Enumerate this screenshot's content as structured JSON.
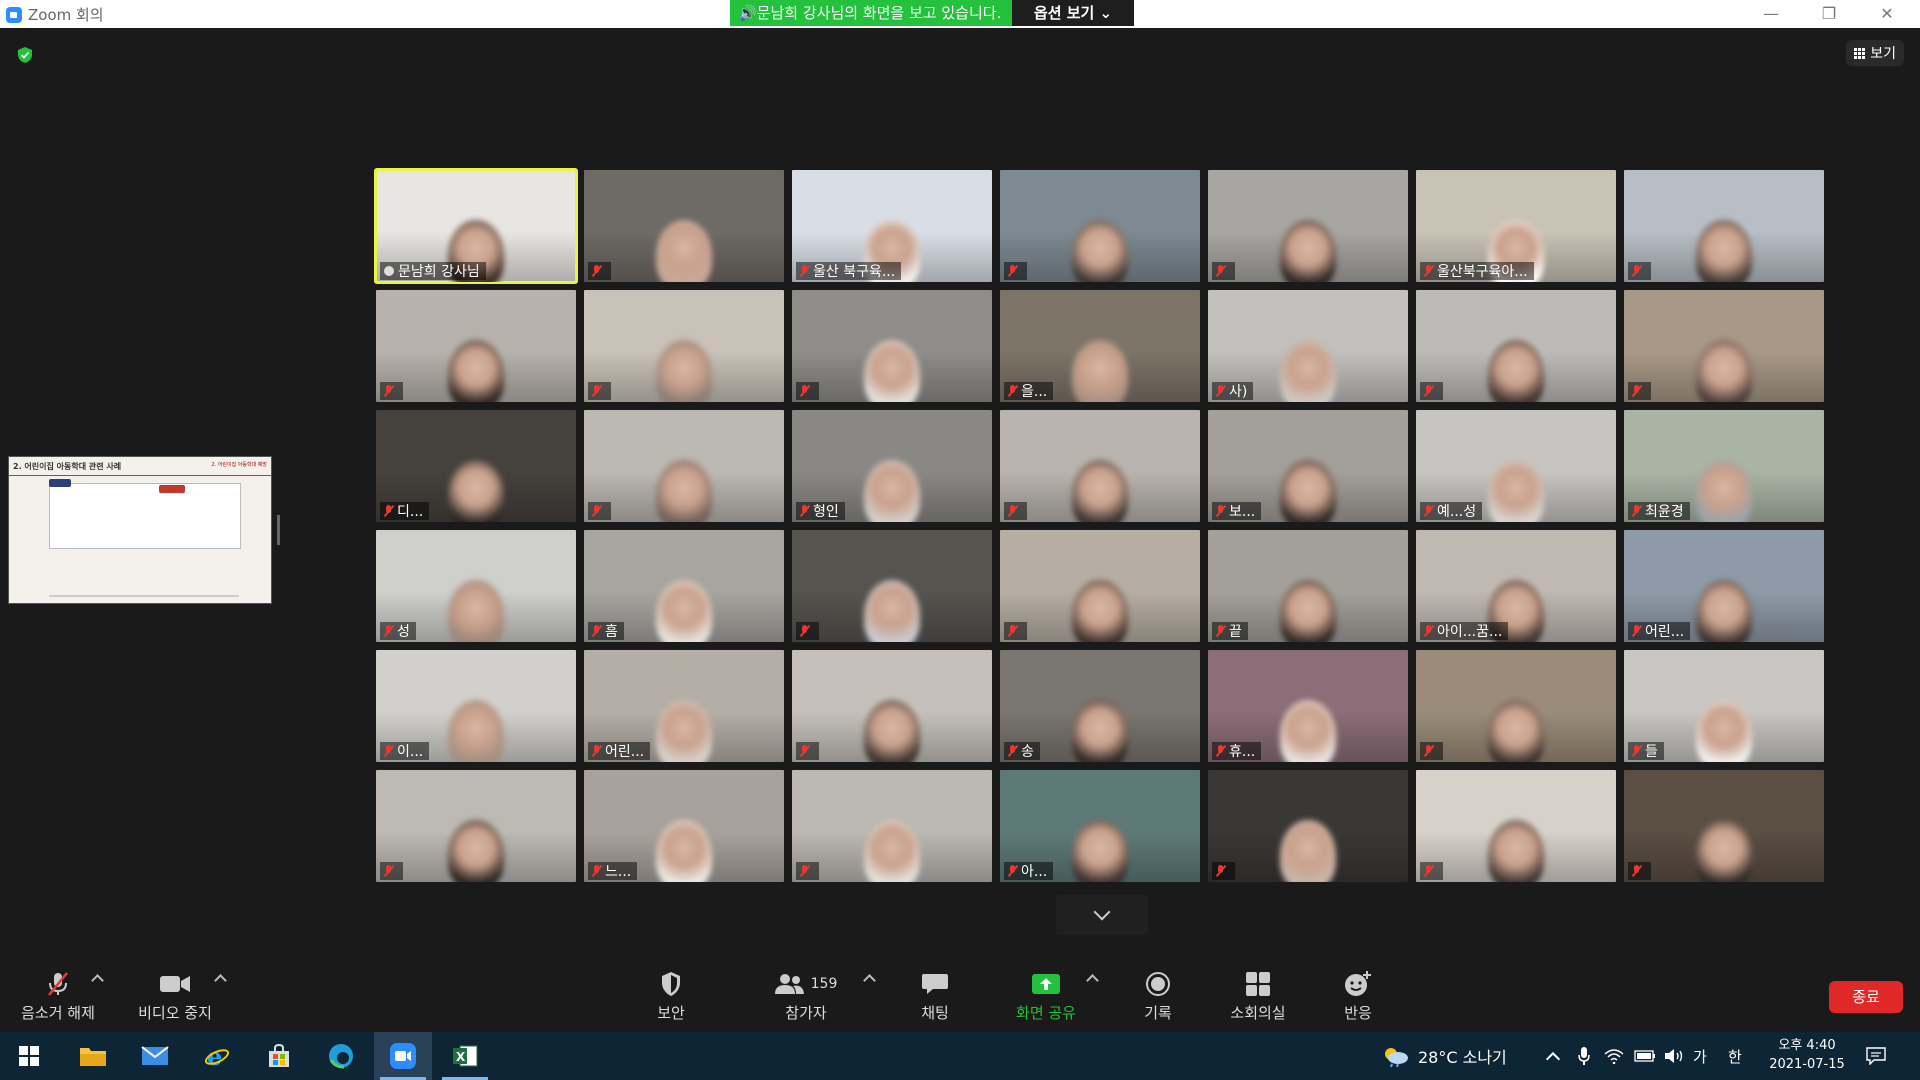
{
  "window": {
    "title": "Zoom 회의",
    "controls": [
      "—",
      "❐",
      "✕"
    ]
  },
  "banner": {
    "message": "🔊문남희 강사님의 화면을 보고 있습니다.",
    "options": "옵션 보기 ⌄"
  },
  "view_button": {
    "label": "보기"
  },
  "shared_screen": {
    "title": "2. 어린이집 아동학대 관련 사례",
    "tag": "2. 어린이집 아동학대 예방"
  },
  "participants": [
    {
      "name": "문남희 강사님",
      "active": true,
      "muted": false,
      "bg": "#e8e6e3",
      "face": "#3a2a22"
    },
    {
      "name": "",
      "muted": true,
      "bg": "#6e6a66",
      "face": "#c8a899"
    },
    {
      "name": "울산 북구육...",
      "muted": true,
      "bg": "#d9dee6",
      "face": "#f2f2f2"
    },
    {
      "name": "",
      "muted": true,
      "bg": "#7d8a92",
      "face": "#3a3432"
    },
    {
      "name": "",
      "muted": true,
      "bg": "#a8a6a2",
      "face": "#2c2624"
    },
    {
      "name": "울산북구육아...",
      "muted": true,
      "bg": "#c9c3b6",
      "face": "#ffffff"
    },
    {
      "name": "",
      "muted": true,
      "bg": "#b8bec6",
      "face": "#3e3532"
    },
    {
      "name": "",
      "muted": true,
      "bg": "#b7b2ab",
      "face": "#2b2522"
    },
    {
      "name": "",
      "muted": true,
      "bg": "#c9c2b8",
      "face": "#8a7c74"
    },
    {
      "name": "",
      "muted": true,
      "bg": "#8e8d89",
      "face": "#e4e2df"
    },
    {
      "name": "을...",
      "muted": true,
      "bg": "#7d7468",
      "face": "#a88f80"
    },
    {
      "name": "사)",
      "muted": true,
      "bg": "#c2c0bc",
      "face": "#cfcac6"
    },
    {
      "name": "",
      "muted": true,
      "bg": "#bdbbb8",
      "face": "#3d302c"
    },
    {
      "name": "",
      "muted": true,
      "bg": "#a89886",
      "face": "#4a3c3a"
    },
    {
      "name": "디...",
      "muted": true,
      "bg": "#45413d",
      "face": "#2a2624"
    },
    {
      "name": "",
      "muted": true,
      "bg": "#bcb8b2",
      "face": "#6e5e58"
    },
    {
      "name": "형인",
      "muted": true,
      "bg": "#8a8885",
      "face": "#d4d0cc"
    },
    {
      "name": "",
      "muted": true,
      "bg": "#b9b4ad",
      "face": "#3a3231"
    },
    {
      "name": "보...",
      "muted": true,
      "bg": "#a39f99",
      "face": "#2c2624"
    },
    {
      "name": "예...성",
      "muted": true,
      "bg": "#c7c5c1",
      "face": "#d9d6d2"
    },
    {
      "name": "최윤경",
      "muted": true,
      "bg": "#a9b4a4",
      "face": "#9aa3ad"
    },
    {
      "name": "성",
      "muted": true,
      "bg": "#cfcfcc",
      "face": "#9a8578"
    },
    {
      "name": "흠",
      "muted": true,
      "bg": "#a7a5a0",
      "face": "#e8e5e1"
    },
    {
      "name": "",
      "muted": true,
      "bg": "#56544f",
      "face": "#c9cdd4"
    },
    {
      "name": "",
      "muted": true,
      "bg": "#b6aea3",
      "face": "#3a2e2a"
    },
    {
      "name": "끝",
      "muted": true,
      "bg": "#a3a09a",
      "face": "#2e2624"
    },
    {
      "name": "아이...꿈...",
      "muted": true,
      "bg": "#c0b9b2",
      "face": "#3b302c"
    },
    {
      "name": "어린...",
      "muted": true,
      "bg": "#8e9aa8",
      "face": "#3a302e"
    },
    {
      "name": "이...",
      "muted": true,
      "bg": "#d2d0cc",
      "face": "#a08e80"
    },
    {
      "name": "어린...",
      "muted": true,
      "bg": "#b4aea6",
      "face": "#d7d3cd"
    },
    {
      "name": "",
      "muted": true,
      "bg": "#c5c1ba",
      "face": "#3b302c"
    },
    {
      "name": "송",
      "muted": true,
      "bg": "#7a7670",
      "face": "#2e2624"
    },
    {
      "name": "휴...",
      "muted": true,
      "bg": "#8c6e78",
      "face": "#e9e6e2"
    },
    {
      "name": "",
      "muted": true,
      "bg": "#9a8c78",
      "face": "#3a302c"
    },
    {
      "name": "들",
      "muted": true,
      "bg": "#c8c6c2",
      "face": "#f2f2f2"
    },
    {
      "name": "",
      "muted": true,
      "bg": "#bdb9b3",
      "face": "#2a2422"
    },
    {
      "name": "느...",
      "muted": true,
      "bg": "#a8a29c",
      "face": "#eceae6"
    },
    {
      "name": "",
      "muted": true,
      "bg": "#bcb8b3",
      "face": "#e4e2df"
    },
    {
      "name": "아...",
      "muted": true,
      "bg": "#5e7a78",
      "face": "#3a2e2c"
    },
    {
      "name": "",
      "muted": true,
      "bg": "#3a3836",
      "face": "#c8b6a8"
    },
    {
      "name": "",
      "muted": true,
      "bg": "#d7d2c9",
      "face": "#3b3230"
    },
    {
      "name": "",
      "muted": true,
      "bg": "#5b4f44",
      "face": "#2e2826"
    }
  ],
  "toolbar": {
    "unmute": "음소거 해제",
    "stop_video": "비디오 중지",
    "security": "보안",
    "participants": "참가자",
    "participant_count": "159",
    "chat": "채팅",
    "share_screen": "화면 공유",
    "record": "기록",
    "breakout": "소회의실",
    "reactions": "반응",
    "end": "종료"
  },
  "taskbar": {
    "weather": "28°C  소나기",
    "ime_ga": "가",
    "ime_han": "한",
    "time": "오후 4:40",
    "date": "2021-07-15"
  },
  "colors": {
    "accent_green": "#23c13c",
    "end_red": "#e02828",
    "active_border": "#e9f542",
    "muted_red": "#e53935"
  }
}
